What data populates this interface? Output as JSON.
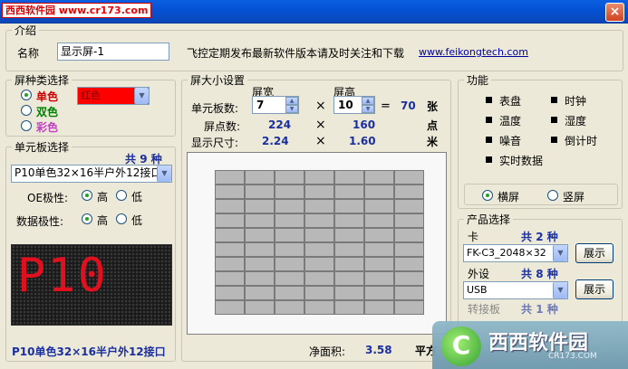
{
  "titlebar": {
    "watermark_brand": "西西软件园",
    "watermark_url": "www.cr173.com",
    "title": "飞控定期发布",
    "close": "×"
  },
  "intro": {
    "legend": "介绍",
    "name_label": "名称",
    "name_value": "显示屏-1",
    "notice": "飞控定期发布最新软件版本请及时关注和下载",
    "website": "www.feikongtech.com"
  },
  "screen_type": {
    "legend": "屏种类选择",
    "single": "单色",
    "dual": "双色",
    "full": "彩色",
    "color_value": "红色",
    "colors": {
      "single": "#d00000",
      "dual": "#008000",
      "full": "#c040c0",
      "swatch": "#ff0000"
    }
  },
  "board": {
    "legend": "单元板选择",
    "total_prefix": "共",
    "total": "9",
    "total_suffix": "种",
    "selected": "P10单色32×16半户外12接口",
    "oe_label": "OE极性:",
    "data_label": "数据极性:",
    "high": "高",
    "low": "低",
    "preview_text": "P10",
    "caption": "P10单色32×16半户外12接口"
  },
  "size": {
    "legend": "屏大小设置",
    "width_label": "屏宽",
    "height_label": "屏高",
    "unit_label": "单元板数:",
    "width_val": "7",
    "height_val": "10",
    "times": "×",
    "equals": "=",
    "total": "70",
    "total_unit": "张",
    "pixel_label": "屏点数:",
    "pixel_w": "224",
    "pixel_h": "160",
    "pixel_unit": "点",
    "size_label": "显示尺寸:",
    "size_w": "2.24",
    "size_h": "1.60",
    "size_unit": "米",
    "grid_cols": 7,
    "grid_rows": 10
  },
  "area": {
    "label": "净面积:",
    "value": "3.58",
    "unit": "平方"
  },
  "functions": {
    "legend": "功能",
    "items": [
      "表盘",
      "时钟",
      "温度",
      "湿度",
      "噪音",
      "倒计时",
      "实时数据"
    ],
    "landscape": "横屏",
    "portrait": "竖屏"
  },
  "product": {
    "legend": "产品选择",
    "card_label": "卡",
    "card_total": "2",
    "card_value": "FK-C3_2048×32",
    "ext_label": "外设",
    "ext_total": "8",
    "ext_value": "USB",
    "adapter_label": "转接板",
    "adapter_total": "1",
    "show": "展示",
    "prefix": "共",
    "suffix": "种"
  },
  "bottom_watermark": {
    "logo": "C",
    "brand": "西西软件园",
    "url": "CR173.COM"
  }
}
